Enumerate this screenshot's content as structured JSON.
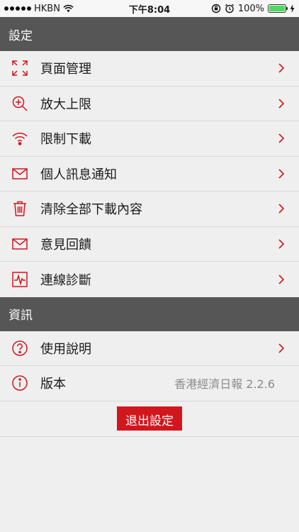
{
  "status_bar": {
    "carrier": "HKBN",
    "time": "下午8:04",
    "battery": "100%",
    "battery_level": 1.0
  },
  "sections": {
    "settings": {
      "title": "設定",
      "items": [
        {
          "label": "頁面管理",
          "icon": "expand-icon"
        },
        {
          "label": "放大上限",
          "icon": "zoom-in-icon"
        },
        {
          "label": "限制下載",
          "icon": "wifi-icon"
        },
        {
          "label": "個人訊息通知",
          "icon": "mail-icon"
        },
        {
          "label": "清除全部下載內容",
          "icon": "trash-icon"
        },
        {
          "label": "意見回饋",
          "icon": "mail-icon"
        },
        {
          "label": "連線診斷",
          "icon": "pulse-icon"
        }
      ]
    },
    "info": {
      "title": "資訊",
      "items": [
        {
          "label": "使用說明",
          "icon": "question-icon"
        },
        {
          "label": "版本",
          "icon": "info-icon",
          "value": "香港經濟日報 2.2.6"
        }
      ]
    }
  },
  "exit_button": "退出設定",
  "colors": {
    "accent": "#d2161d",
    "header_bg": "#565656",
    "background": "#efeff0"
  }
}
